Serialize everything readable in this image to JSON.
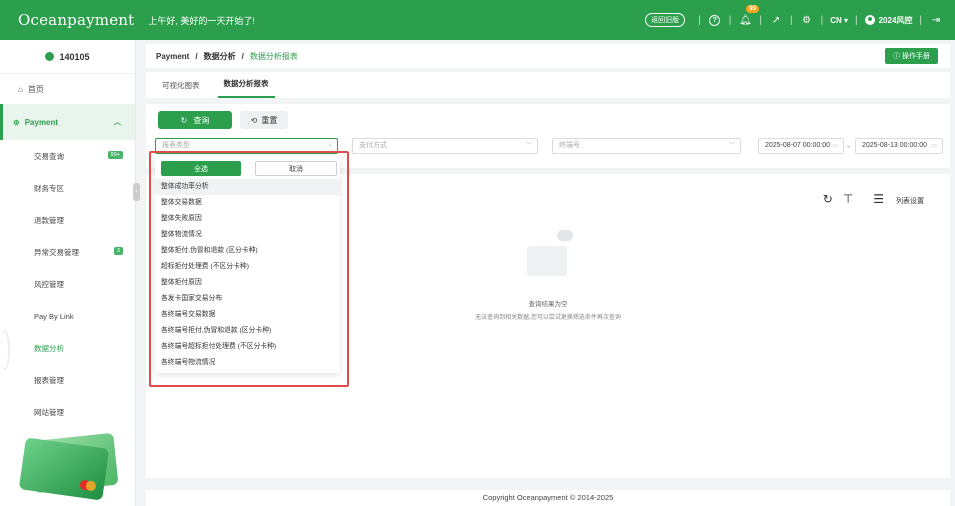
{
  "header": {
    "logo": "Oceanpayment",
    "greeting": "上午好, 美好的一天开始了!",
    "pill": "返回旧版",
    "notifications": "99",
    "lang": "CN ▾",
    "user": "2024风控"
  },
  "sidebar": {
    "merchant": "140105",
    "home": "首页",
    "payment": "Payment",
    "items": [
      {
        "label": "交易查询",
        "badge": "99+"
      },
      {
        "label": "财务专区",
        "badge": ""
      },
      {
        "label": "退款管理",
        "badge": ""
      },
      {
        "label": "异常交易管理",
        "badge": "3"
      },
      {
        "label": "风控管理",
        "badge": ""
      },
      {
        "label": "Pay By Link",
        "badge": ""
      },
      {
        "label": "数据分析",
        "badge": ""
      },
      {
        "label": "报表管理",
        "badge": ""
      },
      {
        "label": "网站管理",
        "badge": ""
      }
    ]
  },
  "breadcrumb": {
    "root": "Payment",
    "mid": "数据分析",
    "current": "数据分析报表"
  },
  "manual": "操作手册",
  "tabs": [
    "可视化图表",
    "数据分析报表"
  ],
  "filter": {
    "query": "查询",
    "reset": "重置",
    "report_type_placeholder": "报表类型",
    "pay_method_placeholder": "支付方式",
    "terminal_placeholder": "终端号",
    "date_start": "2025-08-07 00:00:00",
    "date_end": "2025-08-13 00:00:00"
  },
  "dropdown": {
    "select_all": "全选",
    "cancel": "取消",
    "options": [
      "整体成功率分析",
      "整体交易数据",
      "整体失败原因",
      "整体物流情况",
      "整体拒付,伪冒和退款 (区分卡种)",
      "超标拒付处理费 (不区分卡种)",
      "整体拒付原因",
      "各发卡国家交易分布",
      "各终端号交易数据",
      "各终端号拒付,伪冒和退款 (区分卡种)",
      "各终端号超标拒付处理费 (不区分卡种)",
      "各终端号物流情况"
    ]
  },
  "table": {
    "column_settings": "列表设置",
    "empty_title": "查询结果为空",
    "empty_desc": "无法查询到相关数据,您可以尝试更换筛选条件再次查询"
  },
  "footer": "Copyright Oceanpayment © 2014-2025",
  "colors": {
    "primary": "#2c9f4c",
    "highlight": "#e24b4b"
  }
}
